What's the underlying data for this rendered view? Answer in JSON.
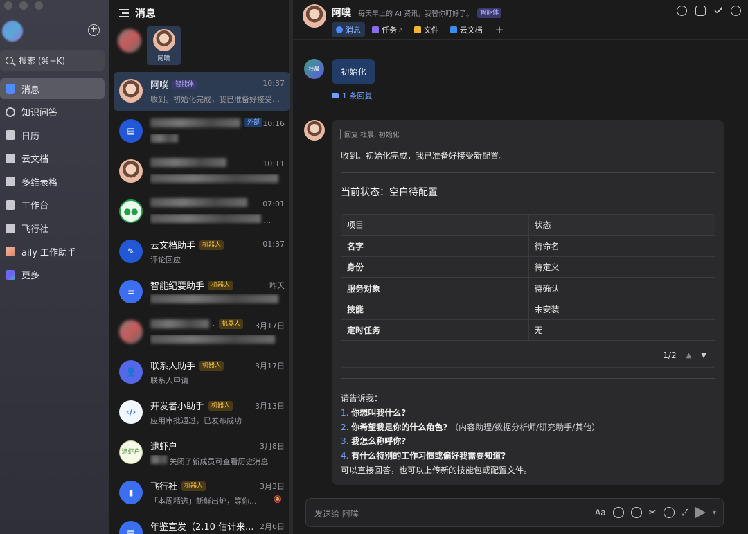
{
  "nav": {
    "search_label": "搜索 (⌘+K)",
    "items": [
      {
        "label": "消息",
        "icon": "message-icon",
        "active": true
      },
      {
        "label": "知识问答",
        "icon": "knowledge-qa-icon"
      },
      {
        "label": "日历",
        "icon": "calendar-icon"
      },
      {
        "label": "云文档",
        "icon": "cloud-doc-icon"
      },
      {
        "label": "多维表格",
        "icon": "base-table-icon"
      },
      {
        "label": "工作台",
        "icon": "workplace-icon"
      },
      {
        "label": "飞行社",
        "icon": "flight-club-icon"
      },
      {
        "label": "aily 工作助手",
        "icon": "aily-icon"
      },
      {
        "label": "更多",
        "icon": "more-apps-icon"
      }
    ]
  },
  "list": {
    "title": "消息",
    "pinned_label": "阿噗",
    "conversations": [
      {
        "name": "阿噗",
        "tag": "智能体",
        "tag_type": "ai",
        "time": "10:37",
        "preview": "收到。初始化完成，我已准备好接受新配置。",
        "selected": true
      },
      {
        "name": "",
        "tag": "外部",
        "tag_type": "ext",
        "time": "10:16",
        "preview": ""
      },
      {
        "name": "",
        "tag": "",
        "time": "10:11",
        "preview": ""
      },
      {
        "name": "",
        "tag": "",
        "time": "07:01",
        "preview": "..."
      },
      {
        "name": "云文档助手",
        "tag": "机器人",
        "tag_type": "bot",
        "time": "01:37",
        "preview": "评论回应"
      },
      {
        "name": "智能纪要助手",
        "tag": "机器人",
        "tag_type": "bot",
        "time": "昨天",
        "preview": ""
      },
      {
        "name": ".",
        "tag": "机器人",
        "tag_type": "bot",
        "time": "3月17日",
        "preview": ""
      },
      {
        "name": "联系人助手",
        "tag": "机器人",
        "tag_type": "bot",
        "time": "3月17日",
        "preview": "联系人申请"
      },
      {
        "name": "开发者小助手",
        "tag": "机器人",
        "tag_type": "bot",
        "time": "3月13日",
        "preview": "应用审批通过，已发布成功"
      },
      {
        "name": "逮虾户",
        "tag": "",
        "time": "3月8日",
        "preview": "关闭了新成员可查看历史消息"
      },
      {
        "name": "飞行社",
        "tag": "机器人",
        "tag_type": "bot",
        "time": "3月3日",
        "preview": "「本周精选」新鲜出炉，等你..."
      },
      {
        "name": "年鉴宣发（2.10 估计来...",
        "tag": "",
        "time": "2月6日",
        "preview": ""
      }
    ],
    "shrimp_avatar": "逮虾户"
  },
  "chat": {
    "name": "阿噗",
    "description": "每天早上的 AI 资讯，我替你盯好了。",
    "tag": "智能体",
    "tabs": [
      {
        "label": "消息",
        "active": true
      },
      {
        "label": "任务"
      },
      {
        "label": "文件"
      },
      {
        "label": "云文档"
      }
    ],
    "plus": "+",
    "user_avatar_label": "杜晨",
    "user_message": "初始化",
    "reply_count": "1 条回复",
    "reply_quote": "回复 杜晨: 初始化",
    "ai_line1": "收到。初始化完成，我已准备好接受新配置。",
    "status_heading": "当前状态：空白待配置",
    "table": {
      "headers": [
        "项目",
        "状态"
      ],
      "rows": [
        [
          "名字",
          "待命名"
        ],
        [
          "身份",
          "待定义"
        ],
        [
          "服务对象",
          "待确认"
        ],
        [
          "技能",
          "未安装"
        ],
        [
          "定时任务",
          "无"
        ]
      ],
      "page": "1/2"
    },
    "ask_intro": "请告诉我：",
    "questions": [
      {
        "num": "1.",
        "text": "你想叫我什么?",
        "sub": ""
      },
      {
        "num": "2.",
        "text": "你希望我是你的什么角色?",
        "sub": "（内容助理/数据分析师/研究助手/其他）"
      },
      {
        "num": "3.",
        "text": "我怎么称呼你?",
        "sub": ""
      },
      {
        "num": "4.",
        "text": "有什么特别的工作习惯或偏好我需要知道?",
        "sub": ""
      }
    ],
    "ask_outro": "可以直接回答，也可以上传新的技能包或配置文件。",
    "input_placeholder": "发送给 阿噗",
    "font_button": "Aa"
  },
  "colors": {
    "accent": "#4f8bff",
    "selected_bg": "#2c3a52",
    "bot_tag": "#f0c04a",
    "ai_tag": "#b9b4ff"
  }
}
